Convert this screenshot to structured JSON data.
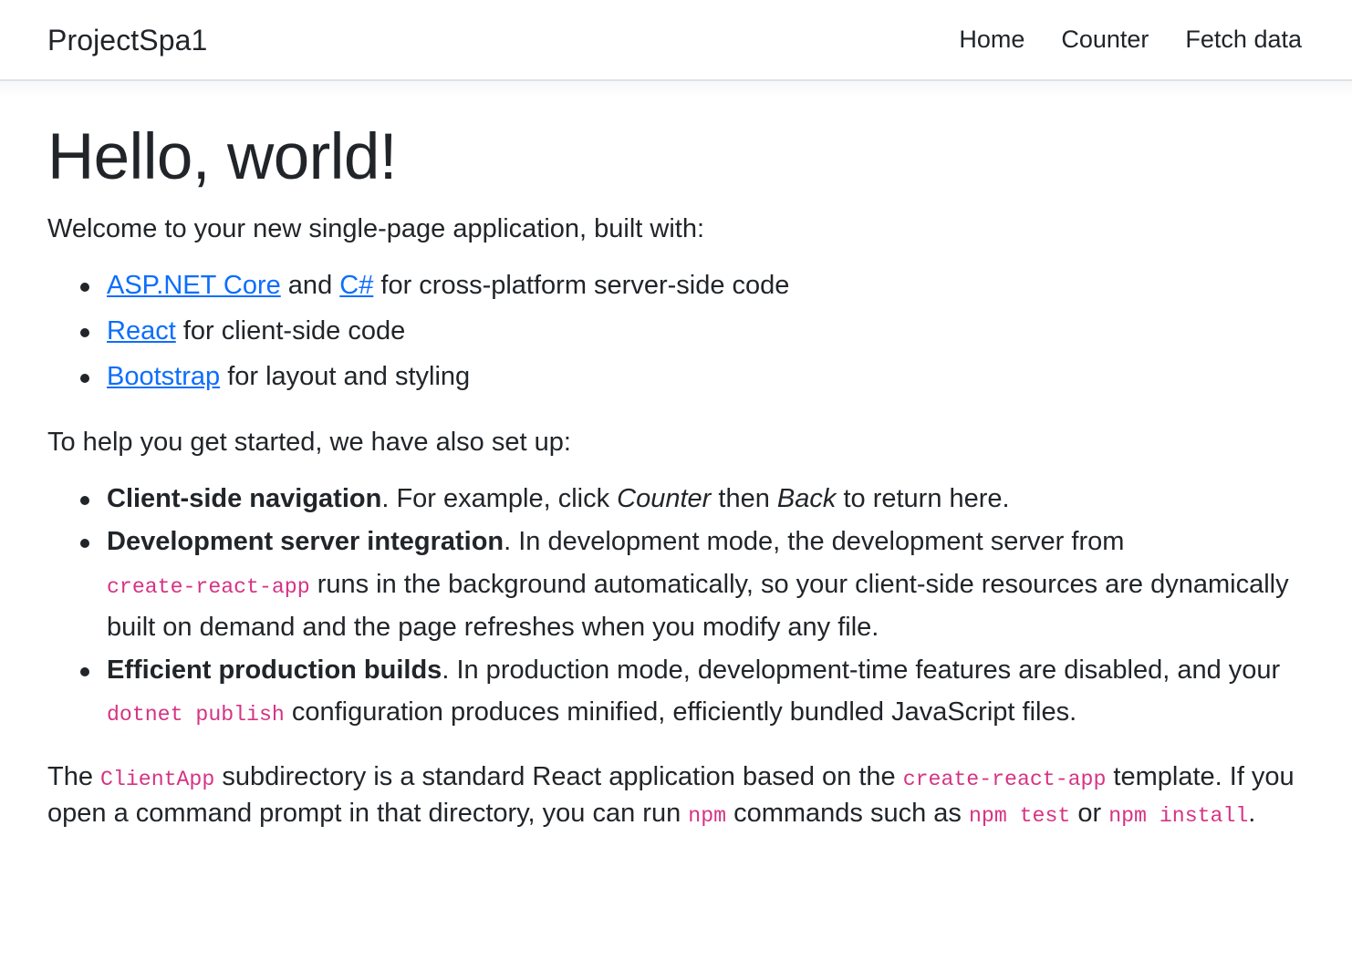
{
  "header": {
    "brand": "ProjectSpa1",
    "nav": [
      {
        "label": "Home"
      },
      {
        "label": "Counter"
      },
      {
        "label": "Fetch data"
      }
    ]
  },
  "main": {
    "title": "Hello, world!",
    "intro": "Welcome to your new single-page application, built with:",
    "tech_list": [
      {
        "link1": "ASP.NET Core",
        "mid": " and ",
        "link2": "C#",
        "tail": " for cross-platform server-side code"
      },
      {
        "link1": "React",
        "tail": " for client-side code"
      },
      {
        "link1": "Bootstrap",
        "tail": " for layout and styling"
      }
    ],
    "setup_intro": "To help you get started, we have also set up:",
    "setup_list": [
      {
        "bold": "Client-side navigation",
        "t1": ". For example, click ",
        "em1": "Counter",
        "t2": " then ",
        "em2": "Back",
        "t3": " to return here."
      },
      {
        "bold": "Development server integration",
        "t1": ". In development mode, the development server from ",
        "code1": "create-react-app",
        "t2": " runs in the background automatically, so your client-side resources are dynamically built on demand and the page refreshes when you modify any file."
      },
      {
        "bold": "Efficient production builds",
        "t1": ". In production mode, development-time features are disabled, and your ",
        "code1": "dotnet publish",
        "t2": " configuration produces minified, efficiently bundled JavaScript files."
      }
    ],
    "final_paragraph": {
      "t1": "The ",
      "code1": "ClientApp",
      "t2": " subdirectory is a standard React application based on the ",
      "code2": "create-react-app",
      "t3": " template. If you open a command prompt in that directory, you can run ",
      "code3": "npm",
      "t4": " commands such as ",
      "code4": "npm test",
      "t5": " or ",
      "code5": "npm install",
      "t6": "."
    }
  },
  "colors": {
    "link": "#0d6efd",
    "code": "#d63384",
    "text": "#212529",
    "border": "#dee2e6"
  }
}
